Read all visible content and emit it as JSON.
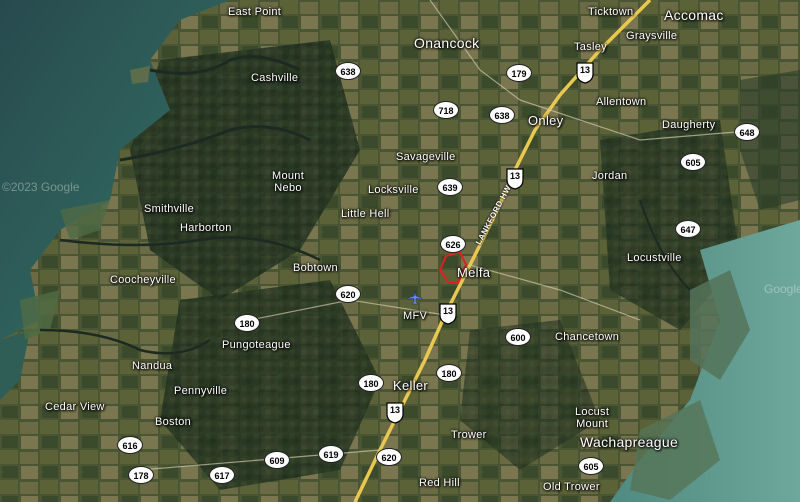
{
  "places": [
    {
      "id": "east-point",
      "label": "East Point",
      "cls": "place"
    },
    {
      "id": "onancock",
      "label": "Onancock",
      "cls": "place big"
    },
    {
      "id": "ticktown",
      "label": "Ticktown",
      "cls": "place"
    },
    {
      "id": "accomac",
      "label": "Accomac",
      "cls": "place big"
    },
    {
      "id": "tasley",
      "label": "Tasley",
      "cls": "place"
    },
    {
      "id": "graysville",
      "label": "Graysville",
      "cls": "place"
    },
    {
      "id": "cashville",
      "label": "Cashville",
      "cls": "place"
    },
    {
      "id": "allentown",
      "label": "Allentown",
      "cls": "place"
    },
    {
      "id": "onley",
      "label": "Onley",
      "cls": "place town"
    },
    {
      "id": "daugherty",
      "label": "Daugherty",
      "cls": "place"
    },
    {
      "id": "savageville",
      "label": "Savageville",
      "cls": "place"
    },
    {
      "id": "mount-nebo",
      "label": "Mount\nNebo",
      "cls": "place"
    },
    {
      "id": "jordan",
      "label": "Jordan",
      "cls": "place"
    },
    {
      "id": "locksville",
      "label": "Locksville",
      "cls": "place"
    },
    {
      "id": "smithville",
      "label": "Smithville",
      "cls": "place"
    },
    {
      "id": "little-hell",
      "label": "Little Hell",
      "cls": "place"
    },
    {
      "id": "harborton",
      "label": "Harborton",
      "cls": "place"
    },
    {
      "id": "locustville",
      "label": "Locustville",
      "cls": "place"
    },
    {
      "id": "bobtown",
      "label": "Bobtown",
      "cls": "place"
    },
    {
      "id": "melfa",
      "label": "Melfa",
      "cls": "place town"
    },
    {
      "id": "coocheyville",
      "label": "Coocheyville",
      "cls": "place"
    },
    {
      "id": "mfv",
      "label": "MFV",
      "cls": "place"
    },
    {
      "id": "chancetown",
      "label": "Chancetown",
      "cls": "place"
    },
    {
      "id": "pungoteague",
      "label": "Pungoteague",
      "cls": "place"
    },
    {
      "id": "nandua",
      "label": "Nandua",
      "cls": "place"
    },
    {
      "id": "keller",
      "label": "Keller",
      "cls": "place town"
    },
    {
      "id": "pennyville",
      "label": "Pennyville",
      "cls": "place"
    },
    {
      "id": "cedar-view",
      "label": "Cedar View",
      "cls": "place"
    },
    {
      "id": "boston",
      "label": "Boston",
      "cls": "place"
    },
    {
      "id": "locust-mount",
      "label": "Locust\nMount",
      "cls": "place"
    },
    {
      "id": "trower",
      "label": "Trower",
      "cls": "place"
    },
    {
      "id": "wachapreague",
      "label": "Wachapreague",
      "cls": "place big"
    },
    {
      "id": "red-hill",
      "label": "Red Hill",
      "cls": "place"
    },
    {
      "id": "old-trower",
      "label": "Old Trower",
      "cls": "place"
    }
  ],
  "routes": [
    {
      "id": "r638a",
      "label": "638"
    },
    {
      "id": "r179",
      "label": "179"
    },
    {
      "id": "r718",
      "label": "718"
    },
    {
      "id": "r638b",
      "label": "638"
    },
    {
      "id": "r648",
      "label": "648"
    },
    {
      "id": "r605a",
      "label": "605"
    },
    {
      "id": "r639",
      "label": "639"
    },
    {
      "id": "r626",
      "label": "626"
    },
    {
      "id": "r647",
      "label": "647"
    },
    {
      "id": "r620a",
      "label": "620"
    },
    {
      "id": "r180a",
      "label": "180"
    },
    {
      "id": "r600",
      "label": "600"
    },
    {
      "id": "r180b",
      "label": "180"
    },
    {
      "id": "r180c",
      "label": "180"
    },
    {
      "id": "r616",
      "label": "616"
    },
    {
      "id": "r178",
      "label": "178"
    },
    {
      "id": "r617",
      "label": "617"
    },
    {
      "id": "r609",
      "label": "609"
    },
    {
      "id": "r619",
      "label": "619"
    },
    {
      "id": "r620b",
      "label": "620"
    },
    {
      "id": "r605b",
      "label": "605"
    }
  ],
  "shields": [
    {
      "id": "us13a",
      "label": "13"
    },
    {
      "id": "us13b",
      "label": "13"
    },
    {
      "id": "us13c",
      "label": "13"
    },
    {
      "id": "us13d",
      "label": "13"
    }
  ],
  "road_label": "LANKFORD HWY",
  "watermark": "©2023 Google",
  "watermark2": "Google",
  "colors": {
    "water": "#3f7a72",
    "land": "#3c4a2e",
    "highway": "#e8c850",
    "highlight": "#e02020"
  }
}
